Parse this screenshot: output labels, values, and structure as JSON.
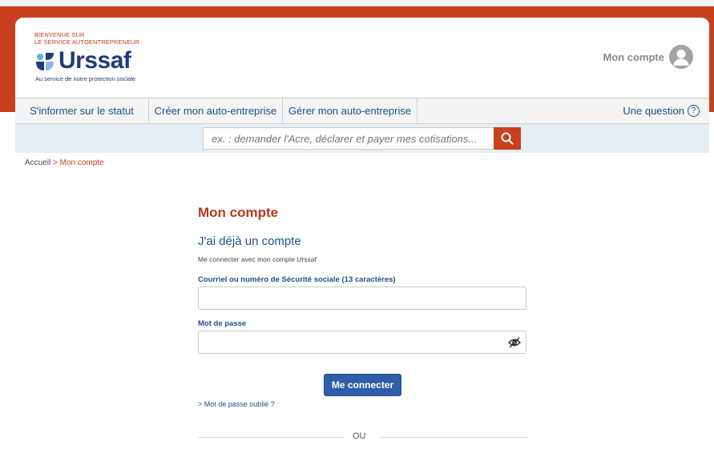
{
  "header": {
    "welcome_line1": "BIENVENUE SUR",
    "welcome_line2": "LE SERVICE AUTOENTREPRENEUR",
    "logo_text": "Urssaf",
    "logo_tagline": "Au service de notre protection sociale",
    "account_label": "Mon compte",
    "account_icon": "user-avatar-icon"
  },
  "nav": {
    "items": [
      {
        "label": "S'informer sur le statut"
      },
      {
        "label": "Créer mon auto-entreprise"
      },
      {
        "label": "Gérer mon auto-entreprise"
      }
    ],
    "help_label": "Une question",
    "help_icon": "?"
  },
  "search": {
    "placeholder": "ex. : demander l'Acre, déclarer et payer mes cotisations..."
  },
  "breadcrumb": {
    "home": "Accueil",
    "separator": ">",
    "current": "Mon compte"
  },
  "main": {
    "title": "Mon compte",
    "subtitle": "J'ai déjà un compte",
    "description": "Me connecter avec mon compte Urssaf",
    "email_label": "Courriel ou numéro de Sécurité sociale (13 caractères)",
    "email_value": "",
    "password_label": "Mot de passe",
    "password_value": "",
    "connect_button": "Me connecter",
    "forgot_link": "> Mot de passe oublié ?",
    "divider_text": "OU"
  },
  "colors": {
    "brand_red": "#c9401e",
    "brand_blue": "#1f4e8c",
    "button_blue": "#2e5ea8"
  }
}
